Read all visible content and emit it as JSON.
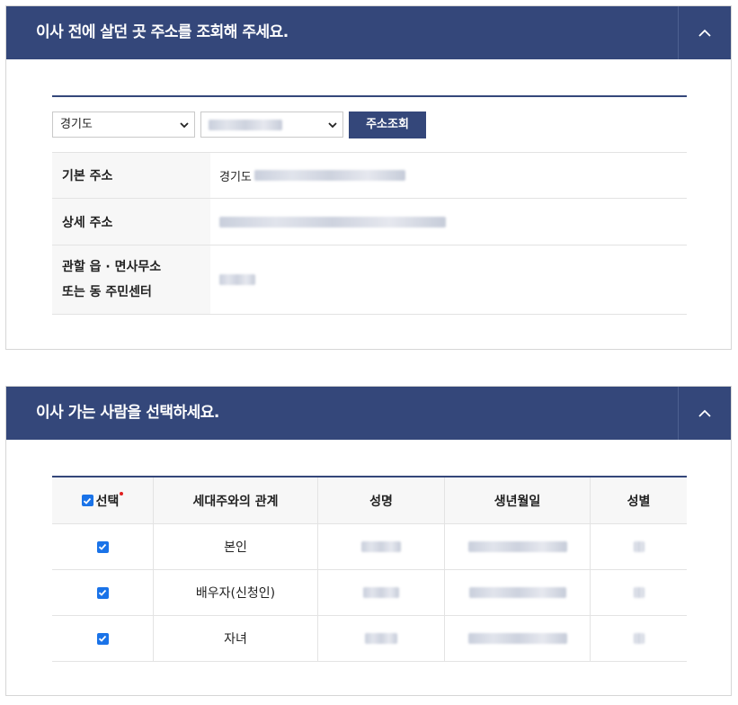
{
  "section1": {
    "title": "이사 전에 살던 곳 주소를 조회해 주세요.",
    "province_select": {
      "value": "경기도"
    },
    "search_button": "주소조회",
    "rows": [
      {
        "label": "기본 주소",
        "value_prefix": "경기도"
      },
      {
        "label": "상세 주소"
      },
      {
        "label_line1": "관할 읍 · 면사무소",
        "label_line2": "또는 동 주민센터"
      }
    ]
  },
  "section2": {
    "title": "이사 가는 사람을 선택하세요.",
    "columns": [
      "선택",
      "세대주와의 관계",
      "성명",
      "생년월일",
      "성별"
    ],
    "people": [
      {
        "relation": "본인",
        "checked": true
      },
      {
        "relation": "배우자(신청인)",
        "checked": true
      },
      {
        "relation": "자녀",
        "checked": true
      }
    ]
  },
  "colors": {
    "header": "#34477a",
    "checkbox": "#1a73e8",
    "required_dot": "#e02020"
  },
  "icons": {
    "panel_toggle": "chevron-up-icon",
    "select_arrow": "chevron-down-icon",
    "checkbox": "check-icon"
  }
}
